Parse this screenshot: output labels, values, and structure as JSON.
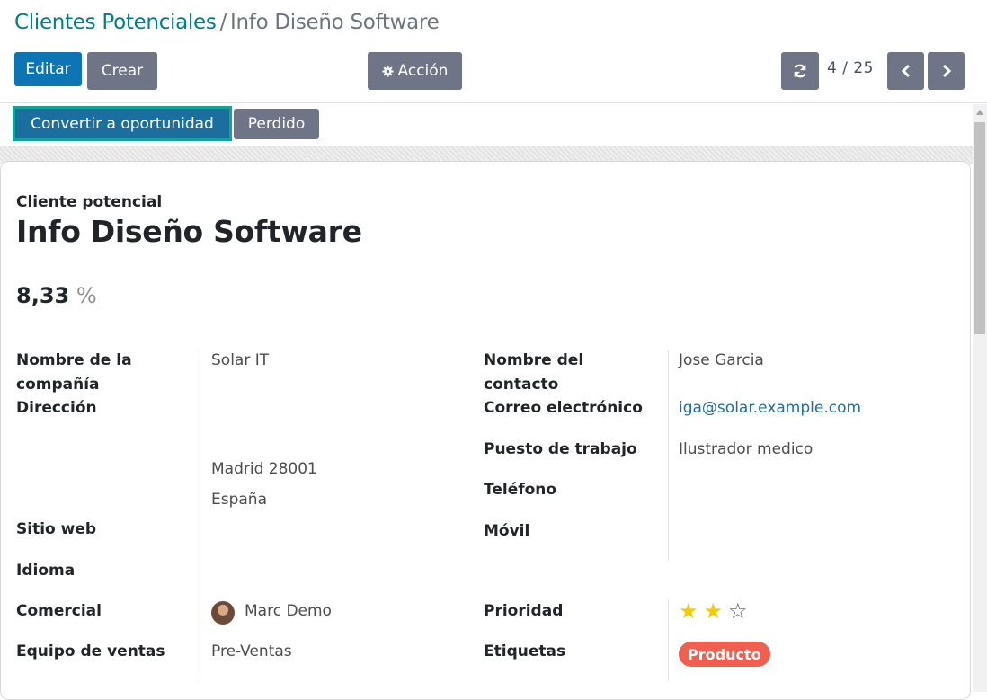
{
  "breadcrumb": {
    "parent": "Clientes Potenciales",
    "separator": "/",
    "current": "Info Diseño Software"
  },
  "toolbar": {
    "edit_label": "Editar",
    "create_label": "Crear",
    "action_label": "Acción",
    "action_icon": "gear-icon",
    "refresh_icon": "refresh-icon",
    "pager": "4 / 25",
    "prev_icon": "chevron-left-icon",
    "next_icon": "chevron-right-icon"
  },
  "statusbar": {
    "convert_label": "Convertir a oportunidad",
    "lost_label": "Perdido"
  },
  "record": {
    "subtitle": "Cliente potencial",
    "title": "Info Diseño Software",
    "probability": "8,33",
    "probability_unit": "%"
  },
  "left_fields": {
    "company_label": "Nombre de la compañía",
    "company_value": "Solar IT",
    "address_label": "Dirección",
    "address_city_zip": "Madrid  28001",
    "address_country": "España",
    "website_label": "Sitio web",
    "language_label": "Idioma",
    "salesperson_label": "Comercial",
    "salesperson_value": "Marc Demo",
    "team_label": "Equipo de ventas",
    "team_value": "Pre-Ventas"
  },
  "right_fields": {
    "contact_label": "Nombre del contacto",
    "contact_value": "Jose Garcia",
    "email_label": "Correo electrónico",
    "email_value": "iga@solar.example.com",
    "job_label": "Puesto de trabajo",
    "job_value": "Ilustrador medico",
    "phone_label": "Teléfono",
    "mobile_label": "Móvil",
    "priority_label": "Prioridad",
    "priority_stars_filled": 2,
    "priority_stars_total": 3,
    "tags_label": "Etiquetas",
    "tag_value": "Producto"
  },
  "colors": {
    "primary": "#0e75b5",
    "secondary": "#6f7486",
    "link": "#017e84",
    "tag": "#f06050",
    "star": "#f3cc00"
  }
}
